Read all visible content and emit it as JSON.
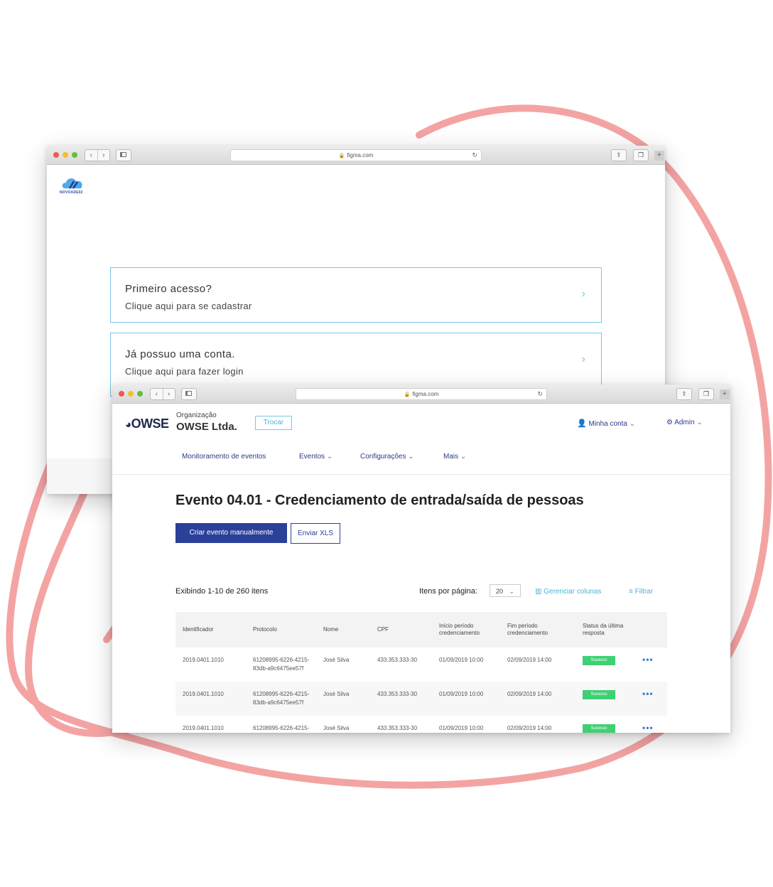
{
  "window_back": {
    "url": "figma.com",
    "logo_text": "NOVOADE02",
    "cards": [
      {
        "title": "Primeiro acesso?",
        "subtitle": "Clique aqui para se cadastrar"
      },
      {
        "title": "Já possuo uma conta.",
        "subtitle": "Clique aqui para fazer login"
      }
    ]
  },
  "window_front": {
    "url": "figma.com",
    "brand": "OWSE",
    "org": {
      "label": "Organização",
      "name": "OWSE Ltda.",
      "switch_label": "Trocar"
    },
    "account": {
      "my_account": "Minha conta",
      "admin": "Admin"
    },
    "nav": [
      "Monitoramento de eventos",
      "Eventos",
      "Configurações",
      "Mais"
    ],
    "page_title": "Evento 04.01 - Credenciamento de entrada/saída de pessoas",
    "actions": {
      "create": "Criar evento manualmente",
      "upload": "Enviar XLS"
    },
    "listing": {
      "showing": "Exibindo 1-10 de 260 itens",
      "per_page_label": "Itens por página:",
      "per_page_value": "20",
      "manage_columns": "Gerenciar colunas",
      "filter": "Filtrar"
    },
    "table": {
      "headers": [
        "Identificador",
        "Protocolo",
        "Nome",
        "CPF",
        "Início período credenciamento",
        "Fim período credenciamento",
        "Status da última resposta"
      ],
      "rows": [
        {
          "id": "2019.0401.1010",
          "protocol_1": "61208995-6226-4215-",
          "protocol_2": "83db-a9c6475ee57f",
          "name": "José Silva",
          "cpf": "433.353.333-30",
          "start": "01/09/2019 10:00",
          "end": "02/09/2019 14:00",
          "status": "Sucesso"
        },
        {
          "id": "2019.0401.1010",
          "protocol_1": "61208995-6226-4215-",
          "protocol_2": "83db-a9c6475ee57f",
          "name": "José Silva",
          "cpf": "433.353.333-30",
          "start": "01/09/2019 10:00",
          "end": "02/09/2019 14:00",
          "status": "Sucesso"
        },
        {
          "id": "2019.0401.1010",
          "protocol_1": "61208995-6226-4215-",
          "protocol_2": "",
          "name": "José Silva",
          "cpf": "433.353.333-30",
          "start": "01/09/2019 10:00",
          "end": "02/09/2019 14:00",
          "status": "Sucesso"
        }
      ]
    }
  },
  "colors": {
    "accent_blue": "#2b4099",
    "cyan": "#4cb3d8",
    "success": "#3fd074",
    "loop": "#f4a3a3"
  }
}
